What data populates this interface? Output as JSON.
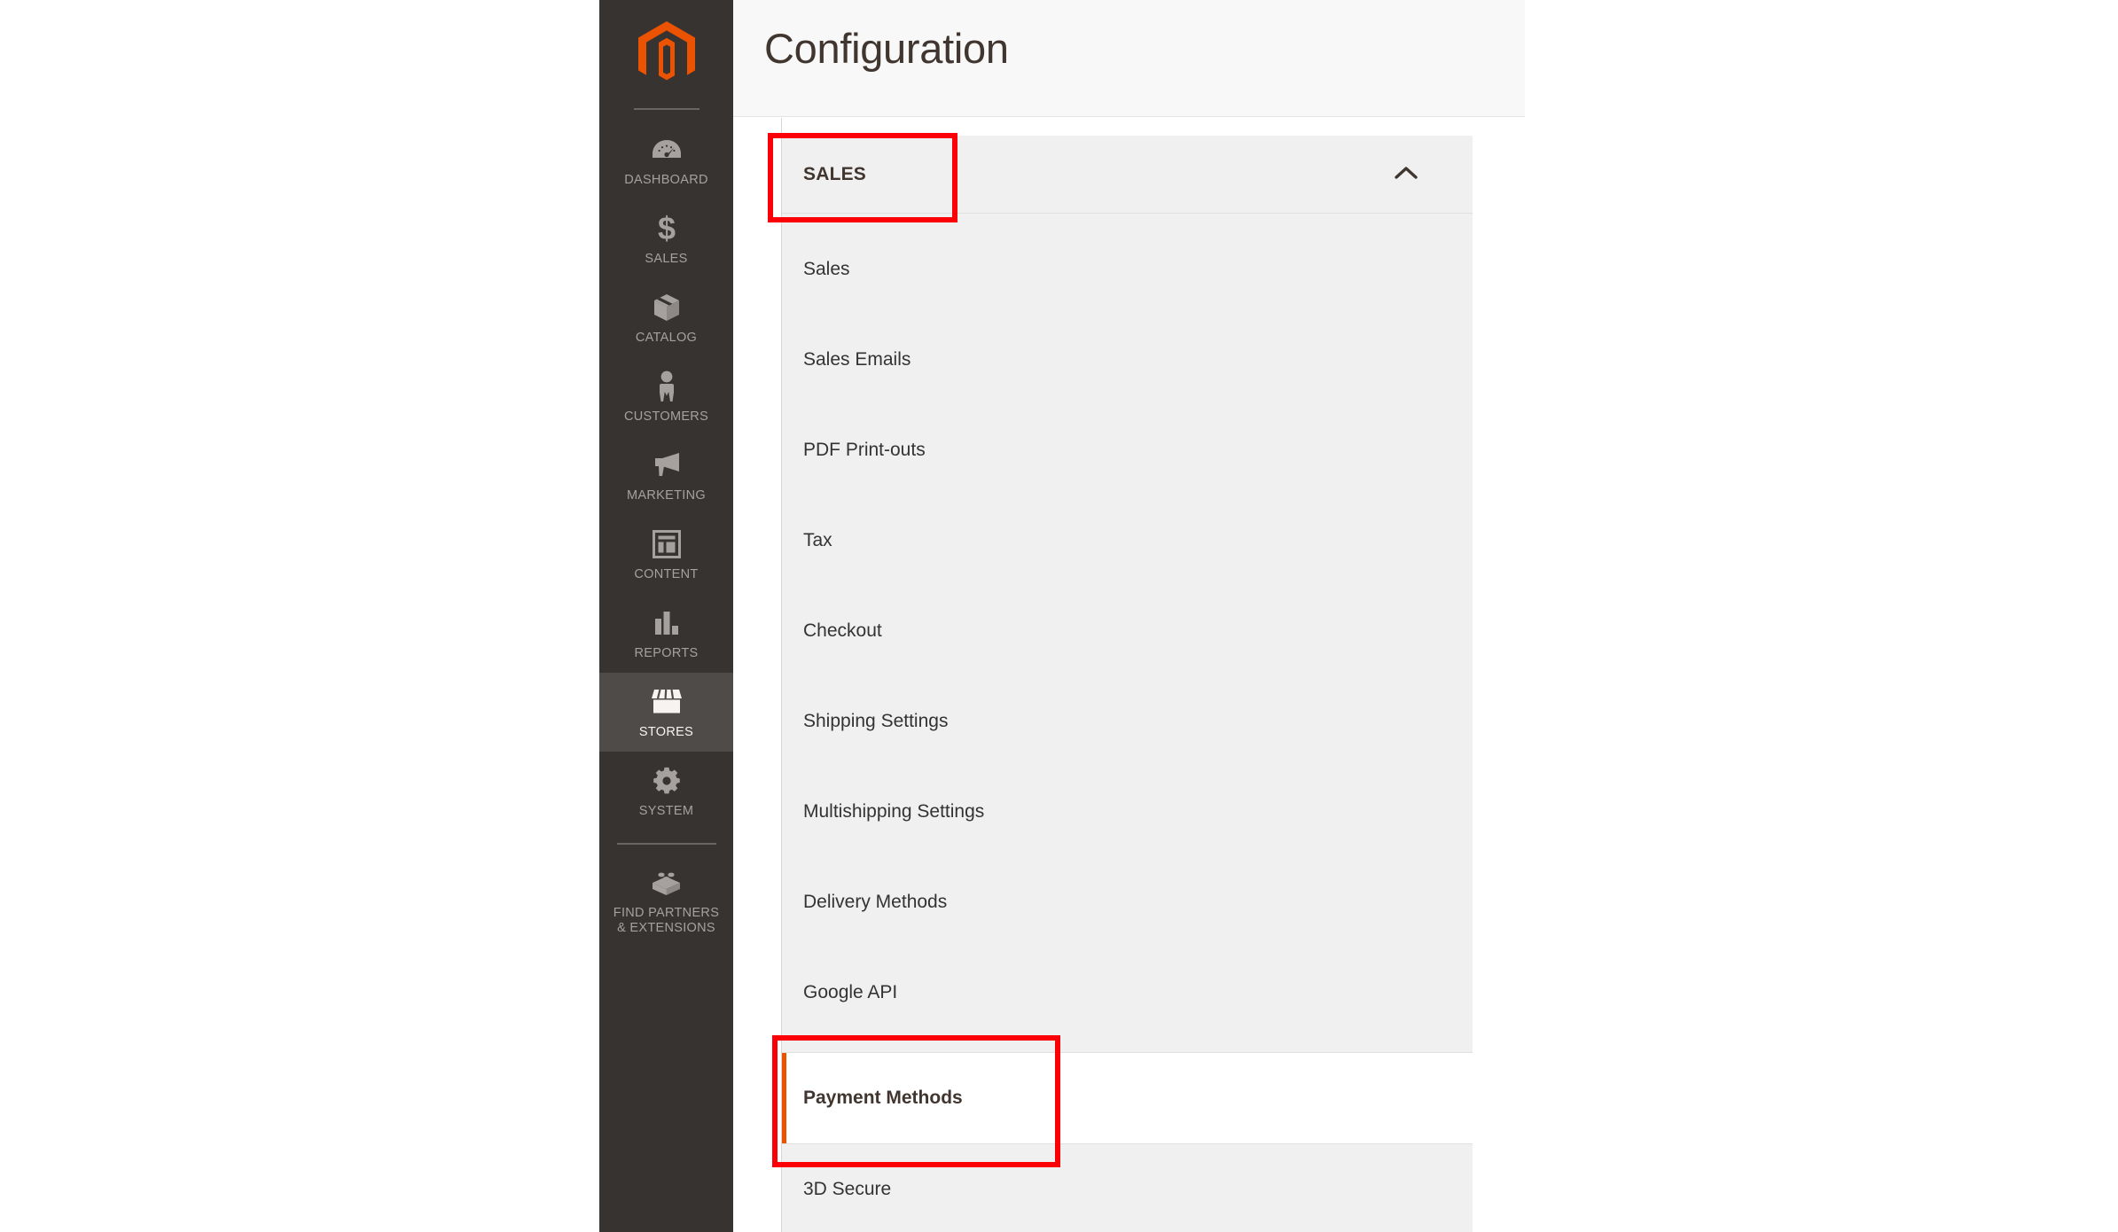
{
  "app": {
    "brand": "magento-logo",
    "accent_color": "#eb5202",
    "sidebar_bg": "#373330",
    "annotation_color": "#fb0007"
  },
  "sidebar": {
    "items": [
      {
        "label": "DASHBOARD",
        "icon": "dashboard-gauge-icon",
        "active": false
      },
      {
        "label": "SALES",
        "icon": "dollar-sign-icon",
        "active": false
      },
      {
        "label": "CATALOG",
        "icon": "box-package-icon",
        "active": false
      },
      {
        "label": "CUSTOMERS",
        "icon": "person-icon",
        "active": false
      },
      {
        "label": "MARKETING",
        "icon": "megaphone-icon",
        "active": false
      },
      {
        "label": "CONTENT",
        "icon": "layout-page-icon",
        "active": false
      },
      {
        "label": "REPORTS",
        "icon": "bar-chart-icon",
        "active": false
      },
      {
        "label": "STORES",
        "icon": "storefront-icon",
        "active": true
      },
      {
        "label": "SYSTEM",
        "icon": "gear-icon",
        "active": false
      },
      {
        "label": "FIND PARTNERS\n& EXTENSIONS",
        "icon": "lego-brick-icon",
        "active": false
      }
    ],
    "find_partners_line1": "FIND PARTNERS",
    "find_partners_line2": "& EXTENSIONS"
  },
  "header": {
    "title": "Configuration"
  },
  "config": {
    "section": {
      "title": "SALES",
      "expanded": true,
      "collapse_icon": "chevron-up-icon"
    },
    "menu_items": [
      {
        "label": "Sales",
        "active": false
      },
      {
        "label": "Sales Emails",
        "active": false
      },
      {
        "label": "PDF Print-outs",
        "active": false
      },
      {
        "label": "Tax",
        "active": false
      },
      {
        "label": "Checkout",
        "active": false
      },
      {
        "label": "Shipping Settings",
        "active": false
      },
      {
        "label": "Multishipping Settings",
        "active": false
      },
      {
        "label": "Delivery Methods",
        "active": false
      },
      {
        "label": "Google API",
        "active": false
      },
      {
        "label": "Payment Methods",
        "active": true
      },
      {
        "label": "3D Secure",
        "active": false
      }
    ]
  },
  "annotations": [
    {
      "name": "sales-section-highlight",
      "target": "SALES"
    },
    {
      "name": "payment-methods-highlight",
      "target": "Payment Methods"
    }
  ]
}
